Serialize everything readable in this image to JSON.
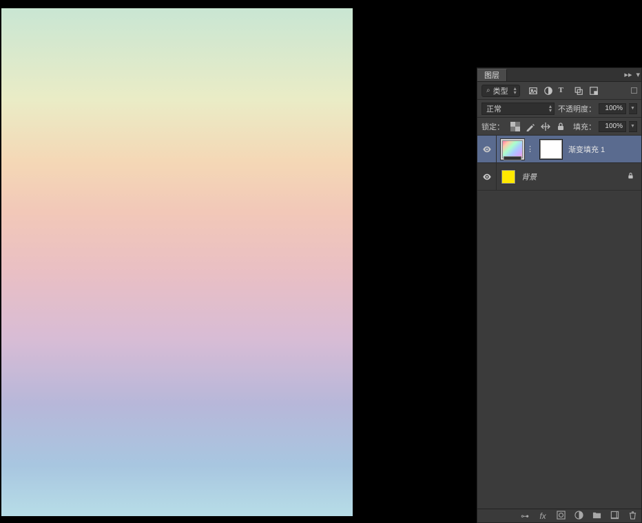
{
  "panel": {
    "title": "图层",
    "filter_label": "类型",
    "blend_mode": "正常",
    "opacity_label": "不透明度：",
    "opacity_value": "100%",
    "fill_label": "填充：",
    "fill_value": "100%",
    "lock_label": "锁定："
  },
  "layers": [
    {
      "name": "渐变填充 1",
      "visible": true,
      "selected": true,
      "hasMask": true,
      "locked": false
    },
    {
      "name": "背景",
      "visible": true,
      "selected": false,
      "hasMask": false,
      "locked": true
    }
  ]
}
